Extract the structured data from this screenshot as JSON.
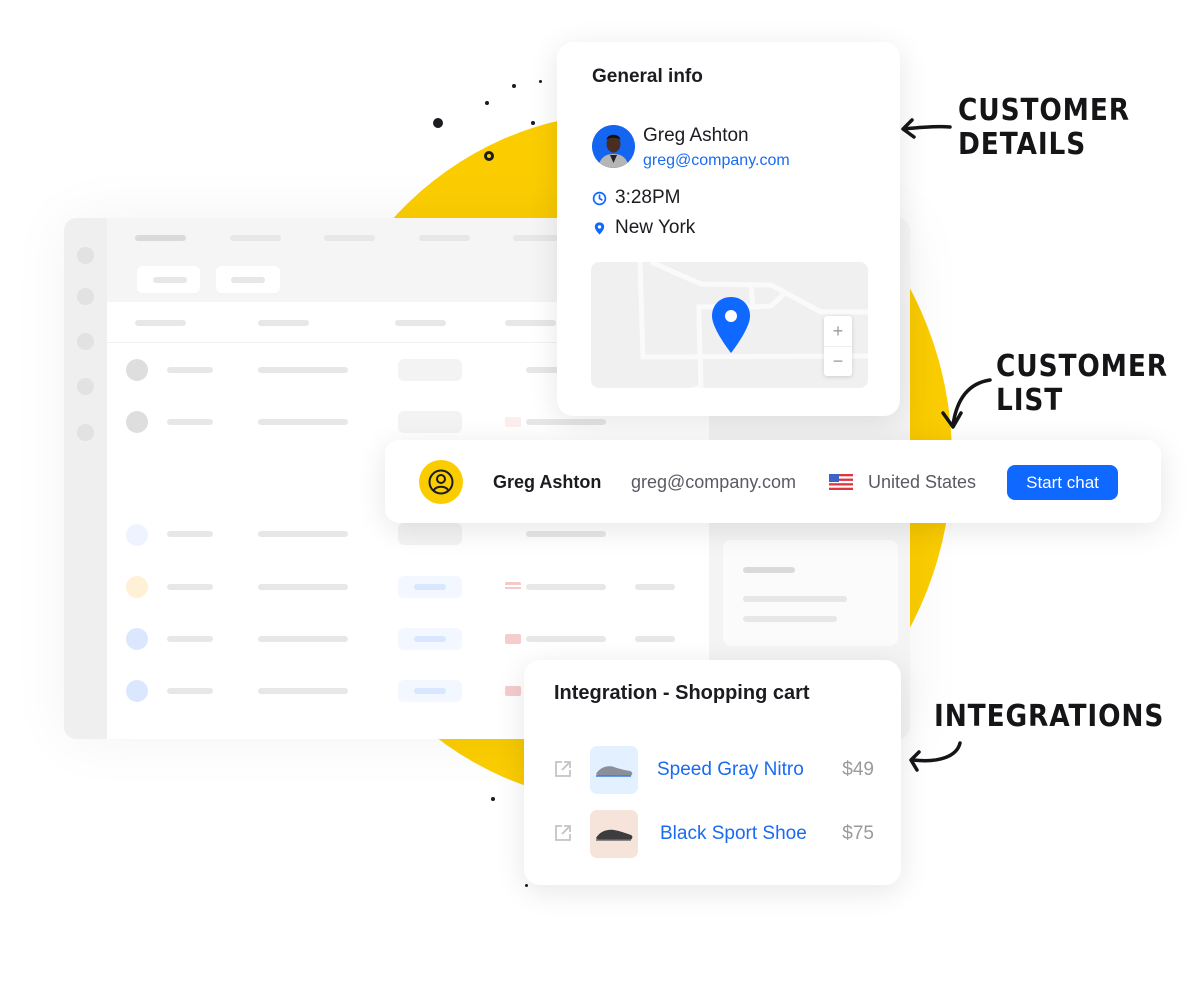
{
  "colors": {
    "accent_yellow": "#fbcd00",
    "brand_blue": "#0f68ff",
    "link_blue": "#1a6bf2",
    "text_dark": "#1b1b20",
    "text_muted": "#9a9a9a"
  },
  "general_info": {
    "title": "General info",
    "customer": {
      "name": "Greg Ashton",
      "email": "greg@company.com",
      "avatar_icon": "user-photo"
    },
    "time": "3:28PM",
    "time_icon": "clock-icon",
    "location": "New York",
    "location_icon": "map-pin-icon",
    "map": {
      "zoom_in_label": "+",
      "zoom_out_label": "−"
    }
  },
  "customer_list_row": {
    "avatar_icon": "user-circle-icon",
    "name": "Greg Ashton",
    "email": "greg@company.com",
    "country_flag": "us-flag-icon",
    "country": "United States",
    "action_label": "Start chat"
  },
  "integration": {
    "title": "Integration - Shopping cart",
    "items": [
      {
        "name": "Speed Gray Nitro",
        "price": "$49",
        "icon": "external-link-icon"
      },
      {
        "name": "Black Sport Shoe",
        "price": "$75",
        "icon": "external-link-icon"
      }
    ]
  },
  "annotations": {
    "customer_details": [
      "CUSTOMER",
      "DETAILS"
    ],
    "customer_list": [
      "CUSTOMER",
      "LIST"
    ],
    "integrations": [
      "INTEGRATIONS"
    ]
  }
}
